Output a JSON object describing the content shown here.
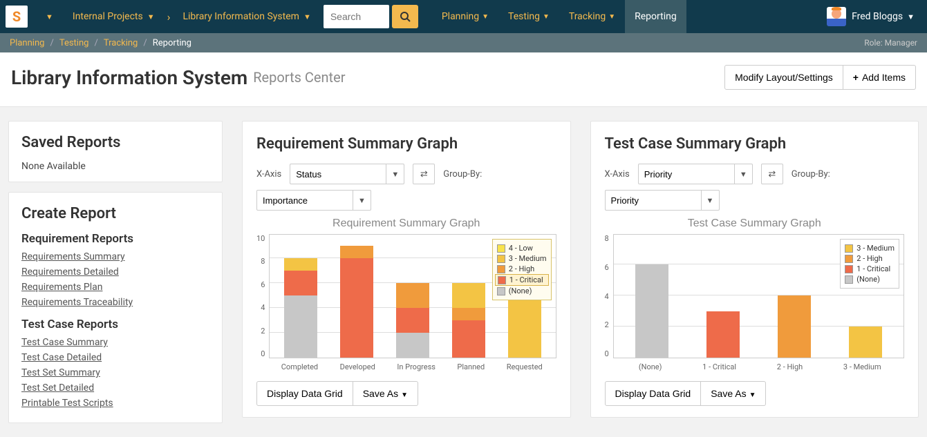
{
  "topnav": {
    "workspace": "Internal Projects",
    "project": "Library Information System",
    "search_placeholder": "Search",
    "items": [
      {
        "label": "Planning"
      },
      {
        "label": "Testing"
      },
      {
        "label": "Tracking"
      },
      {
        "label": "Reporting",
        "active": true
      }
    ],
    "user": "Fred Bloggs"
  },
  "breadcrumb": {
    "items": [
      "Planning",
      "Testing",
      "Tracking"
    ],
    "current": "Reporting",
    "role": "Role: Manager"
  },
  "page": {
    "title": "Library Information System",
    "subtitle": "Reports Center",
    "modify_btn": "Modify Layout/Settings",
    "add_btn": "Add Items"
  },
  "saved_reports": {
    "title": "Saved Reports",
    "empty": "None Available"
  },
  "create_report": {
    "title": "Create Report",
    "sections": [
      {
        "heading": "Requirement Reports",
        "links": [
          "Requirements Summary",
          "Requirements Detailed",
          "Requirements Plan",
          "Requirements Traceability"
        ]
      },
      {
        "heading": "Test Case Reports",
        "links": [
          "Test Case Summary",
          "Test Case Detailed",
          "Test Set Summary",
          "Test Set Detailed",
          "Printable Test Scripts"
        ]
      }
    ]
  },
  "labels": {
    "xaxis": "X-Axis",
    "groupby": "Group-By:",
    "display_grid": "Display Data Grid",
    "save_as": "Save As"
  },
  "colors": {
    "low": "#f8e34c",
    "medium": "#f3c444",
    "high": "#f09b3c",
    "critical": "#ee6b4a",
    "none": "#c7c7c7"
  },
  "chart_data": [
    {
      "title": "Requirement Summary Graph",
      "chart_title": "Requirement Summary Graph",
      "xaxis_selected": "Status",
      "groupby_selected": "Importance",
      "type": "bar",
      "stacked": true,
      "ylim": [
        0,
        10
      ],
      "yticks": [
        0,
        2,
        4,
        6,
        8,
        10
      ],
      "categories": [
        "Completed",
        "Developed",
        "In Progress",
        "Planned",
        "Requested"
      ],
      "series": [
        {
          "name": "4 - Low",
          "color": "low",
          "values": [
            0,
            0,
            0,
            0,
            0
          ]
        },
        {
          "name": "3 - Medium",
          "color": "medium",
          "values": [
            1,
            0,
            0,
            2,
            6
          ]
        },
        {
          "name": "2 - High",
          "color": "high",
          "values": [
            0,
            1,
            2,
            1,
            0
          ]
        },
        {
          "name": "1 - Critical",
          "color": "critical",
          "values": [
            2,
            8,
            2,
            3,
            0
          ]
        },
        {
          "name": "(None)",
          "color": "none",
          "values": [
            5,
            0,
            2,
            0,
            0
          ]
        }
      ],
      "legend_highlight": "1 - Critical"
    },
    {
      "title": "Test Case Summary Graph",
      "chart_title": "Test Case Summary Graph",
      "xaxis_selected": "Priority",
      "groupby_selected": "Priority",
      "type": "bar",
      "stacked": true,
      "ylim": [
        0,
        8
      ],
      "yticks": [
        0,
        2,
        4,
        6,
        8
      ],
      "categories": [
        "(None)",
        "1 - Critical",
        "2 - High",
        "3 - Medium"
      ],
      "series": [
        {
          "name": "3 - Medium",
          "color": "medium",
          "values": [
            0,
            0,
            0,
            2
          ]
        },
        {
          "name": "2 - High",
          "color": "high",
          "values": [
            0,
            0,
            4,
            0
          ]
        },
        {
          "name": "1 - Critical",
          "color": "critical",
          "values": [
            0,
            3,
            0,
            0
          ]
        },
        {
          "name": "(None)",
          "color": "none",
          "values": [
            6,
            0,
            0,
            0
          ]
        }
      ]
    }
  ]
}
